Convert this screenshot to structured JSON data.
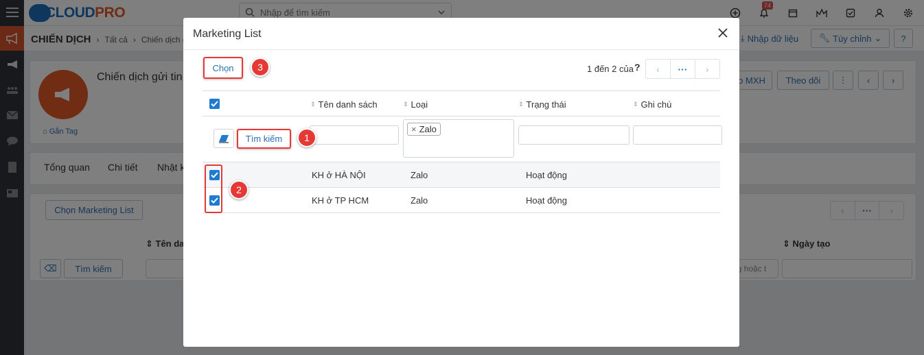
{
  "app": {
    "brand": "CLOUDPRO",
    "brand_part1": "CLOUD",
    "brand_part2": "PRO",
    "search_placeholder": "Nhập để tìm kiếm",
    "notification_count": "74"
  },
  "subbar": {
    "title": "CHIẾN DỊCH",
    "crumb1": "Tất cả",
    "crumb2": "Chiến dịch gửi",
    "import_label": "Nhập dữ liệu",
    "customize_label": "Tùy chỉnh"
  },
  "record": {
    "name": "Chiến dịch gửi tin",
    "tag_label": "Gắn Tag",
    "mxh_label": "o MXH",
    "follow_label": "Theo dõi"
  },
  "record_tabs": [
    "Tổng quan",
    "Chi tiết",
    "Nhật k"
  ],
  "related": {
    "choose_button": "Chọn Marketing List",
    "col_name": "Tên dan",
    "col_created": "Ngày tạo",
    "search_button": "Tìm kiếm",
    "filter_placeholder": "ng hoặc t"
  },
  "modal": {
    "title": "Marketing List",
    "choose_button": "Chọn",
    "pager_text": "1 đến 2 của",
    "pager_help": "?",
    "pager_more": "···",
    "search_button": "Tìm kiếm",
    "type_filter_tag": "Zalo",
    "columns": [
      "Tên danh sách",
      "Loại",
      "Trạng thái",
      "Ghi chú"
    ],
    "rows": [
      {
        "name": "KH ở HÀ NỘI",
        "type": "Zalo",
        "status": "Hoạt động",
        "note": "",
        "checked": true
      },
      {
        "name": "KH ở TP HCM",
        "type": "Zalo",
        "status": "Hoạt động",
        "note": "",
        "checked": true
      }
    ],
    "markers": [
      "1",
      "2",
      "3"
    ]
  },
  "colors": {
    "brand_blue": "#1f6fbd",
    "brand_orange": "#e05a28",
    "highlight_red": "#e53935",
    "checkbox_blue": "#1e7bd0",
    "link_blue": "#2a6fb0"
  }
}
